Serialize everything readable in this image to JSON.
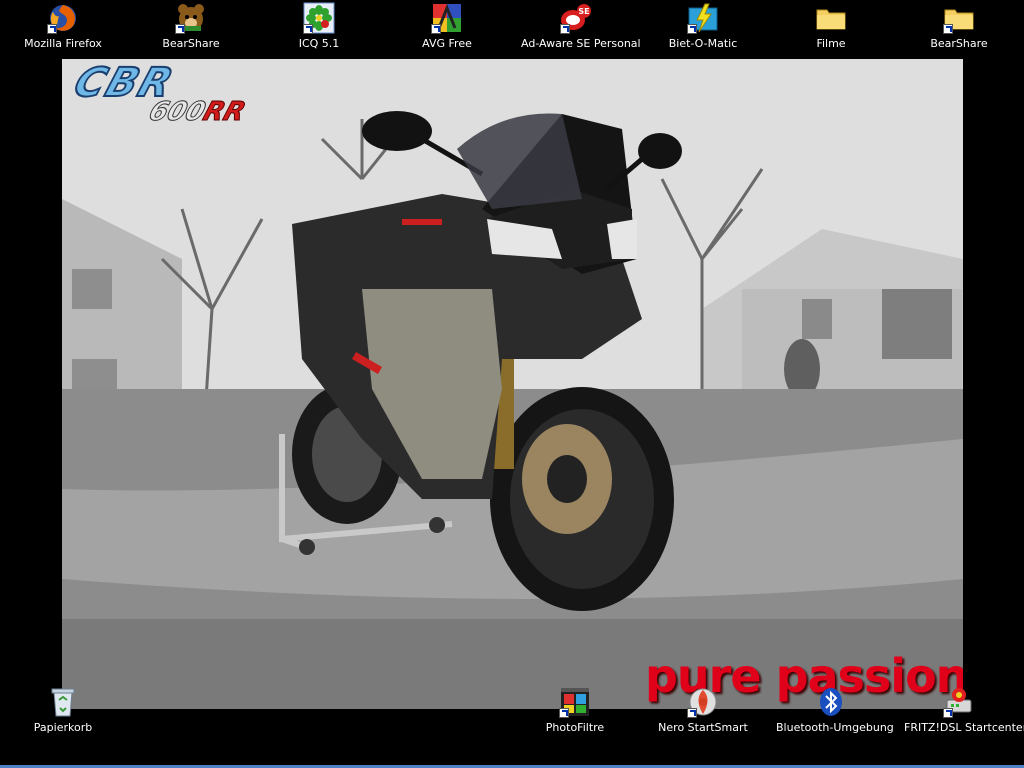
{
  "desktop": {
    "background_color": "#000000",
    "icons_top": [
      {
        "label": "Mozilla Firefox",
        "icon": "firefox-icon",
        "shortcut": true
      },
      {
        "label": "BearShare",
        "icon": "bearshare-icon",
        "shortcut": true
      },
      {
        "label": "ICQ 5.1",
        "icon": "icq-icon",
        "shortcut": true
      },
      {
        "label": "AVG Free",
        "icon": "avg-icon",
        "shortcut": true
      },
      {
        "label": "Ad-Aware SE Personal",
        "icon": "adaware-icon",
        "shortcut": true
      },
      {
        "label": "Biet-O-Matic",
        "icon": "bietomatic-icon",
        "shortcut": true
      },
      {
        "label": "Filme",
        "icon": "folder-icon",
        "shortcut": false
      },
      {
        "label": "BearShare",
        "icon": "folder-icon",
        "shortcut": true
      }
    ],
    "icons_bottom": [
      {
        "label": "Papierkorb",
        "icon": "recycle-bin-icon",
        "shortcut": false
      },
      {
        "label": "PhotoFiltre",
        "icon": "photofiltre-icon",
        "shortcut": true
      },
      {
        "label": "Nero StartSmart",
        "icon": "nero-icon",
        "shortcut": true
      },
      {
        "label": "Bluetooth-Umgebung",
        "icon": "bluetooth-icon",
        "shortcut": false
      },
      {
        "label": "FRITZ!DSL Startcenter",
        "icon": "fritzdsl-icon",
        "shortcut": true
      }
    ]
  },
  "wallpaper": {
    "logo_main": "CBR",
    "logo_sub": "600",
    "logo_sub_accent": "RR",
    "slogan": "pure passion",
    "slogan_color": "#e0001a"
  }
}
